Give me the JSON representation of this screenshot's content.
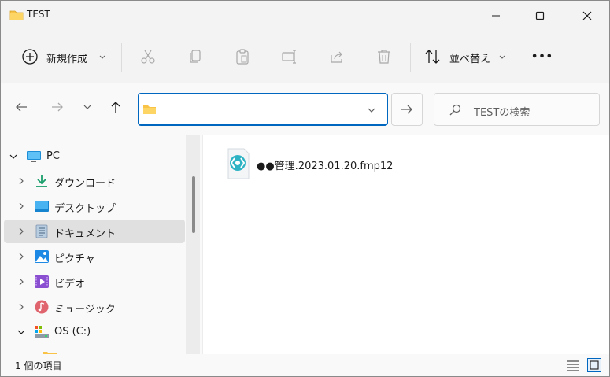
{
  "window": {
    "title": "TEST"
  },
  "toolbar": {
    "new_label": "新規作成",
    "sort_label": "並べ替え",
    "more_label": "•••"
  },
  "search": {
    "placeholder": "TESTの検索"
  },
  "nav": {
    "items": [
      {
        "label": "PC"
      },
      {
        "label": "ダウンロード"
      },
      {
        "label": "デスクトップ"
      },
      {
        "label": "ドキュメント"
      },
      {
        "label": "ピクチャ"
      },
      {
        "label": "ビデオ"
      },
      {
        "label": "ミュージック"
      },
      {
        "label": "OS (C:)"
      }
    ]
  },
  "files": [
    {
      "name": "●●管理.2023.01.20.fmp12"
    }
  ],
  "status": {
    "count": "1 個の項目"
  },
  "colors": {
    "accent": "#0067c0",
    "folder": "#f8c347",
    "selected": "#e0e0e0"
  }
}
